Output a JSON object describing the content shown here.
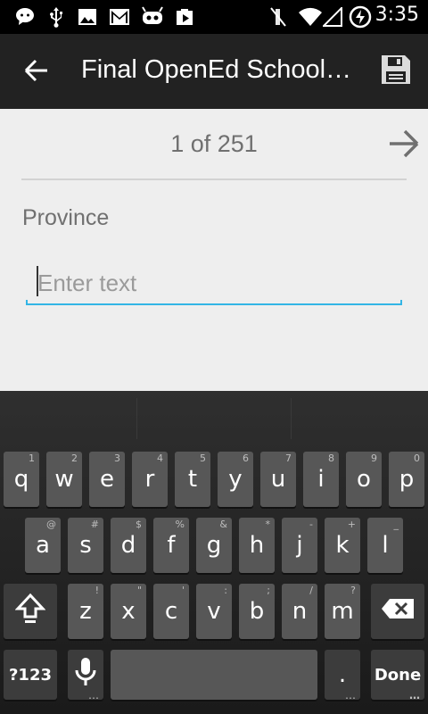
{
  "status_bar": {
    "time": "3:35",
    "icons": [
      "chat-icon",
      "usb-icon",
      "image-icon",
      "gmail-icon",
      "android-icon",
      "play-store-icon",
      "mute-icon",
      "wifi-icon",
      "signal-icon",
      "battery-charging-icon"
    ]
  },
  "action_bar": {
    "title": "Final OpenEd School…",
    "back_icon": "arrow-left-icon",
    "save_icon": "floppy-disk-icon"
  },
  "form": {
    "pager_text": "1 of 251",
    "next_icon": "arrow-right-icon",
    "field_label": "Province",
    "field_value": "",
    "field_placeholder": "Enter text",
    "accent_color": "#33b5e5"
  },
  "keyboard": {
    "row1": [
      {
        "label": "q",
        "hint": "1"
      },
      {
        "label": "w",
        "hint": "2"
      },
      {
        "label": "e",
        "hint": "3"
      },
      {
        "label": "r",
        "hint": "4"
      },
      {
        "label": "t",
        "hint": "5"
      },
      {
        "label": "y",
        "hint": "6"
      },
      {
        "label": "u",
        "hint": "7"
      },
      {
        "label": "i",
        "hint": "8"
      },
      {
        "label": "o",
        "hint": "9"
      },
      {
        "label": "p",
        "hint": "0"
      }
    ],
    "row2": [
      {
        "label": "a",
        "hint": "@"
      },
      {
        "label": "s",
        "hint": "#"
      },
      {
        "label": "d",
        "hint": "$"
      },
      {
        "label": "f",
        "hint": "%"
      },
      {
        "label": "g",
        "hint": "&"
      },
      {
        "label": "h",
        "hint": "*"
      },
      {
        "label": "j",
        "hint": "-"
      },
      {
        "label": "k",
        "hint": "+"
      },
      {
        "label": "l",
        "hint": "_"
      }
    ],
    "row3": [
      {
        "label": "z",
        "hint": "!"
      },
      {
        "label": "x",
        "hint": "\""
      },
      {
        "label": "c",
        "hint": "'"
      },
      {
        "label": "v",
        "hint": ":"
      },
      {
        "label": "b",
        "hint": ";"
      },
      {
        "label": "n",
        "hint": "/"
      },
      {
        "label": "m",
        "hint": "?"
      }
    ],
    "symbols_label": "?123",
    "period_label": ".",
    "done_label": "Done",
    "shift_icon": "shift-icon",
    "backspace_icon": "backspace-icon",
    "mic_icon": "microphone-icon"
  }
}
